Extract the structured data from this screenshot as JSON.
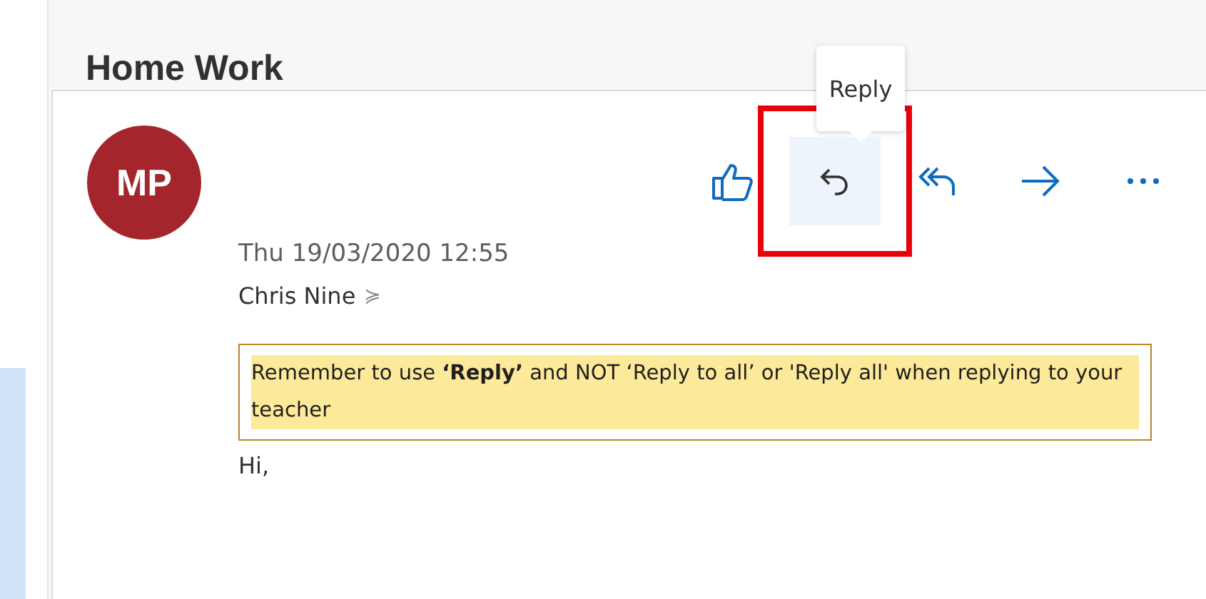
{
  "message": {
    "subject": "Home Work",
    "avatar_initials": "MP",
    "date": "Thu 19/03/2020 12:55",
    "sender": "Chris Nine",
    "expand_glyph": "≽",
    "actions": [
      {
        "kind": "like",
        "hovered": false,
        "highlighted": false
      },
      {
        "kind": "reply",
        "hovered": true,
        "highlighted": true
      },
      {
        "kind": "reply-all",
        "hovered": false,
        "highlighted": false
      },
      {
        "kind": "forward",
        "hovered": false,
        "highlighted": false
      },
      {
        "kind": "more",
        "hovered": false,
        "highlighted": false
      }
    ],
    "tooltip": "Reply",
    "notice": "Remember to use **‘Reply’** and NOT ‘Reply to all’ or 'Reply all' when replying to your teacher",
    "greeting": "Hi,"
  }
}
